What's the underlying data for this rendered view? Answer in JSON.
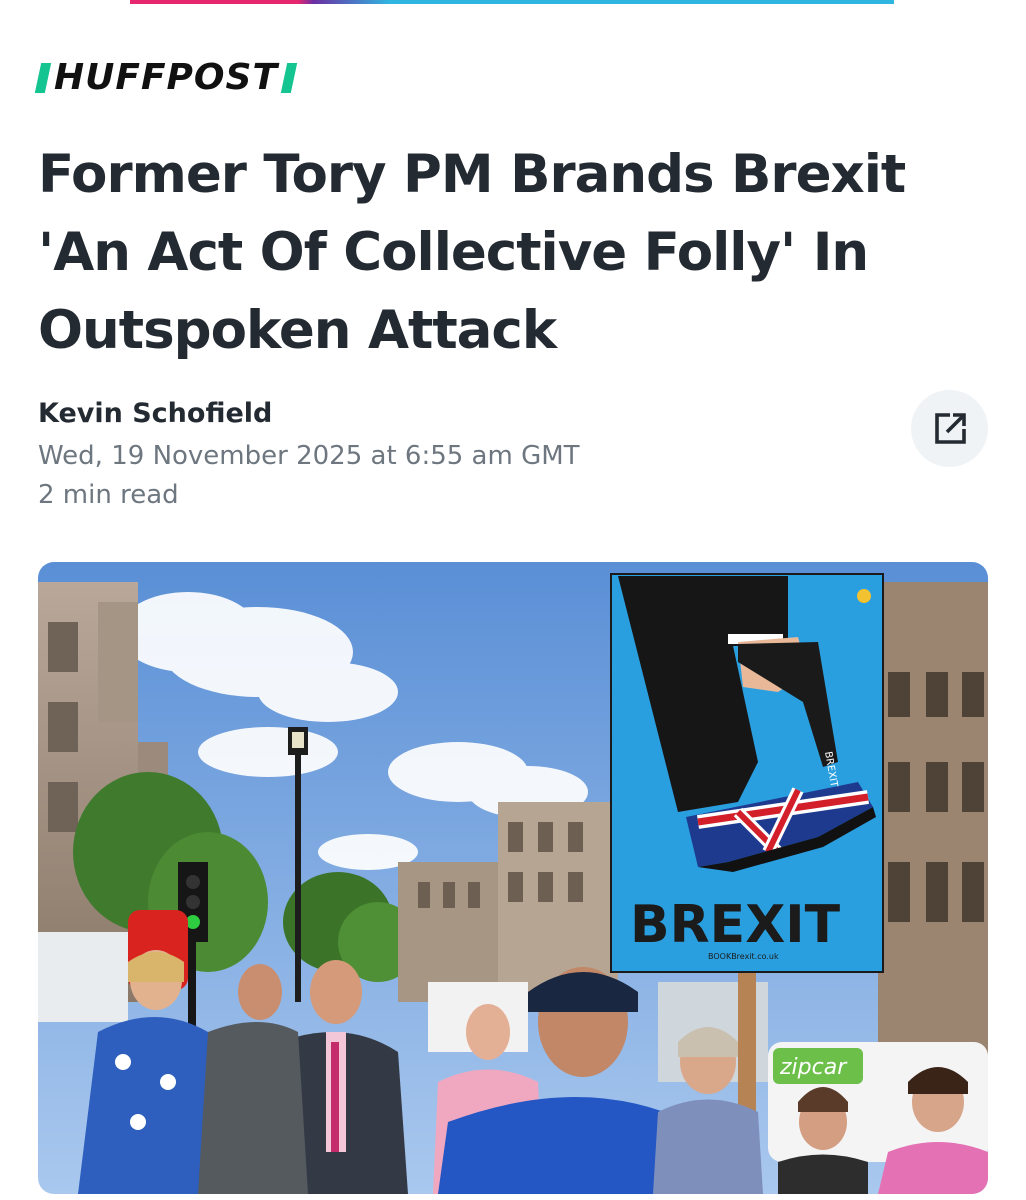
{
  "brand": {
    "logo_text": "HUFFPOST",
    "accent_color": "#14c491",
    "top_bar_colors": [
      "#e6266f",
      "#2fb6e0"
    ]
  },
  "article": {
    "headline": "Former Tory PM Brands Brexit 'An Act Of Collective Folly' In Outspoken Attack",
    "author": "Kevin Schofield",
    "published": "Wed, 19 November 2025 at 6:55 am GMT",
    "read_time": "2 min read"
  },
  "actions": {
    "share_icon": "external-link-icon"
  },
  "hero_image": {
    "placard_text": "BREXIT",
    "placard_gun_text": "BREXIT",
    "placard_small_text": "BOOKBrexit.co.uk",
    "van_text": "zipcar"
  }
}
